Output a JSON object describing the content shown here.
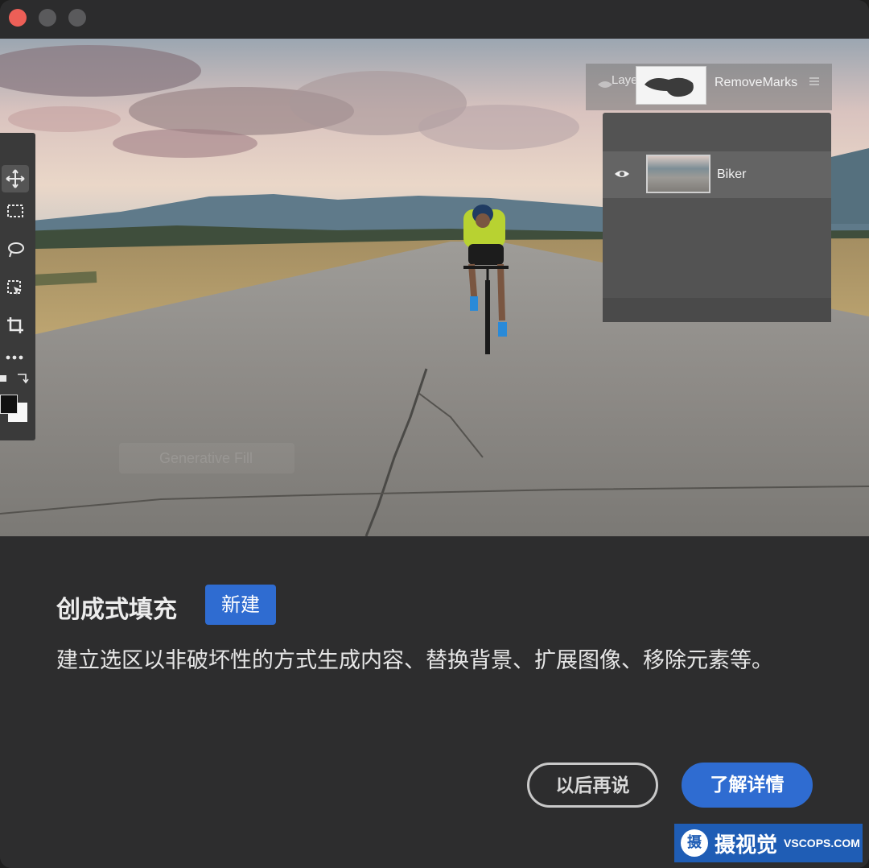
{
  "window": {
    "controls": [
      "close",
      "minimize",
      "maximize"
    ]
  },
  "hero": {
    "layers_panel": {
      "header_label": "Laye",
      "layers": [
        {
          "name": "RemoveMarks",
          "icon": "mask-thumbnail-icon"
        },
        {
          "name": "Biker",
          "icon": "eye-icon"
        }
      ]
    },
    "tools": [
      "move-tool-icon",
      "marquee-tool-icon",
      "lasso-tool-icon",
      "object-select-tool-icon",
      "crop-tool-icon",
      "more-tools-icon",
      "swap-colors-icon",
      "color-swatch-icon"
    ],
    "ghost_label": "Generative Fill"
  },
  "dialog": {
    "title": "创成式填充",
    "badge": "新建",
    "description": "建立选区以非破坏性的方式生成内容、替换背景、扩展图像、移除元素等。",
    "later_button": "以后再说",
    "learn_more_button": "了解详情"
  },
  "watermark": {
    "logo_char": "摄",
    "name": "摄视觉",
    "site": "VSCOPS.COM"
  },
  "colors": {
    "accent": "#2f6cd1",
    "background": "#2d2d2e",
    "close": "#ed5f57",
    "inactive_light": "#5a5a5c"
  }
}
